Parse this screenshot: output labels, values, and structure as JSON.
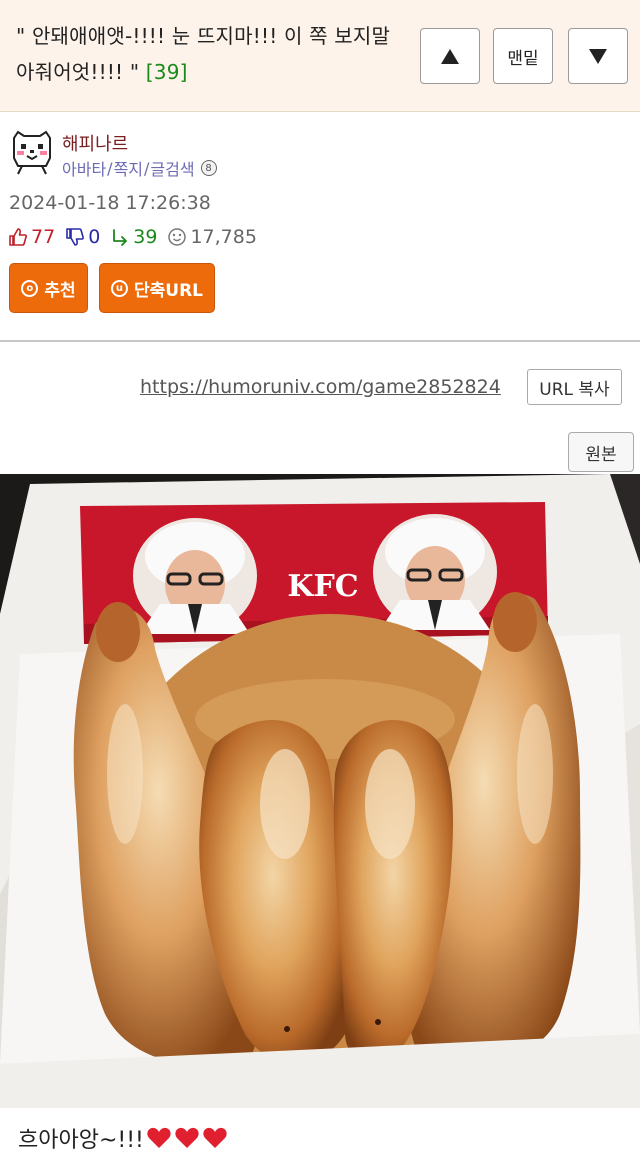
{
  "post": {
    "title": "\" 안돼애애앳-!!!! 눈 뜨지마!!! 이 쪽 보지말아줘어엇!!!! \"",
    "comment_count": "[39]",
    "url": "https://humoruniv.com/game2852824",
    "caption": "흐아아앙~!!!"
  },
  "nav": {
    "up_icon": "arrow-up-icon",
    "bottom_label": "맨밑",
    "down_icon": "arrow-down-icon"
  },
  "author": {
    "name": "해피나르",
    "links": [
      "아바타",
      "쪽지",
      "글검색"
    ],
    "date": "2024-01-18 17:26:38"
  },
  "stats": {
    "likes": "77",
    "dislikes": "0",
    "replies": "39",
    "views": "17,785"
  },
  "buttons": {
    "recommend": "추천",
    "recommend_icon": "ⓞ",
    "short_url": "단축URL",
    "short_url_icon": "ⓤ",
    "url_copy": "URL 복사",
    "original": "원본"
  },
  "photo": {
    "sign_text": "KFC",
    "hearts": 3
  },
  "colors": {
    "header_bg": "#fdf3ea",
    "accent_orange": "#ee6b0b",
    "like_red": "#c0202a",
    "dislike_blue": "#2a2aa8",
    "reply_green": "#1a8a1a",
    "author_name": "#7a1f1f"
  }
}
